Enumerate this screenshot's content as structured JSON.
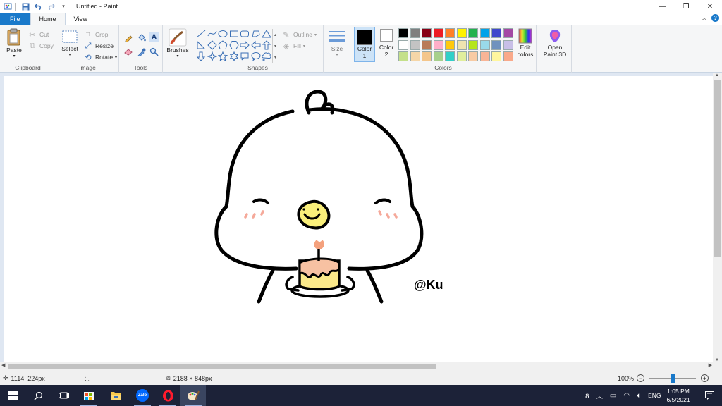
{
  "window": {
    "title": "Untitled - Paint",
    "minimize_glyph": "—",
    "restore_glyph": "❐",
    "close_glyph": "✕"
  },
  "quick_access": {
    "icons": [
      "paint-app-icon",
      "save-icon",
      "undo-icon",
      "redo-icon",
      "customize-dropdown-icon"
    ]
  },
  "tabs": {
    "file": "File",
    "home": "Home",
    "view": "View"
  },
  "ribbon": {
    "clipboard": {
      "label": "Clipboard",
      "paste": "Paste",
      "cut": "Cut",
      "copy": "Copy"
    },
    "image": {
      "label": "Image",
      "select": "Select",
      "crop": "Crop",
      "resize": "Resize",
      "rotate": "Rotate"
    },
    "tools": {
      "label": "Tools"
    },
    "brushes": {
      "label": "Brushes"
    },
    "shapes": {
      "label": "Shapes",
      "outline": "Outline",
      "fill": "Fill"
    },
    "size": {
      "label": "Size"
    },
    "colors": {
      "label": "Colors",
      "color1": "Color",
      "color1_num": "1",
      "color2": "Color",
      "color2_num": "2",
      "color1_value": "#000000",
      "color2_value": "#ffffff",
      "edit_colors_line1": "Edit",
      "edit_colors_line2": "colors",
      "row1": [
        "#000000",
        "#7f7f7f",
        "#880015",
        "#ed1c24",
        "#ff7f27",
        "#fff200",
        "#22b14c",
        "#00a2e8",
        "#3f48cc",
        "#a349a4"
      ],
      "row2": [
        "#ffffff",
        "#c3c3c3",
        "#b97a57",
        "#ffaec9",
        "#ffc90e",
        "#efe4b0",
        "#b5e61d",
        "#99d9ea",
        "#7092be",
        "#c8bfe7"
      ],
      "row3": [
        "#c4e08a",
        "#f5d6a8",
        "#f4c68c",
        "#a7d08c",
        "#30d0c8",
        "#e1ee9c",
        "#f8cba4",
        "#f9b596",
        "#fff69e",
        "#f9a98a"
      ]
    },
    "paint3d": {
      "line1": "Open",
      "line2": "Paint 3D"
    }
  },
  "canvas": {
    "signature": "@Ku"
  },
  "status": {
    "cursor_pos": "1114, 224px",
    "image_size": "2188 × 848px",
    "zoom": "100%",
    "zoom_level": 0.5
  },
  "taskbar": {
    "apps": [
      "start-icon",
      "search-icon",
      "task-view-icon",
      "app-store-icon",
      "file-explorer-icon",
      "zalo-icon",
      "opera-icon",
      "paint-icon"
    ],
    "zalo_text": "Zalo",
    "lang": "ENG",
    "time": "1:05 PM",
    "date": "6/5/2021"
  }
}
